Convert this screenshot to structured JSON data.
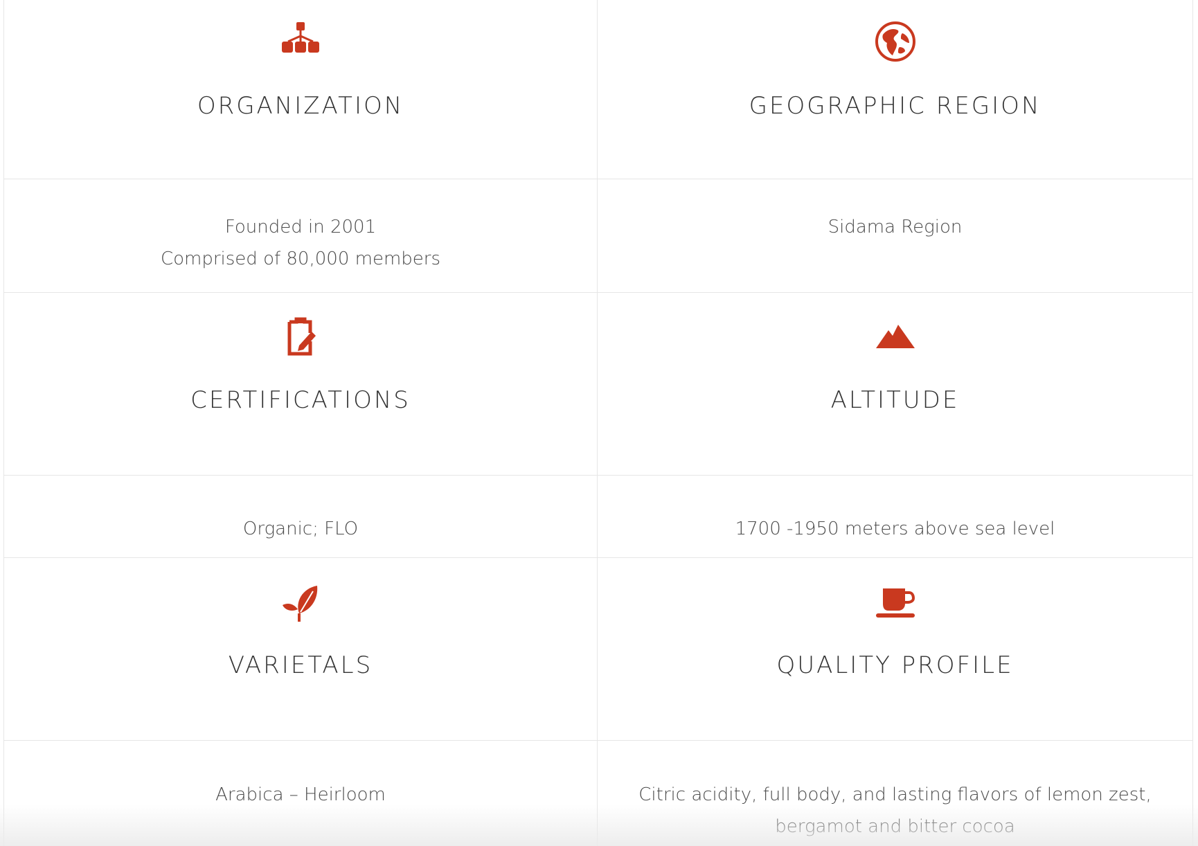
{
  "colors": {
    "accent": "#c9391f",
    "text": "#444444",
    "divider": "#e6e6e6"
  },
  "sections": [
    {
      "heading": "ORGANIZATION",
      "icon": "org-chart-icon",
      "lines": [
        "Founded in 2001",
        "Comprised of 80,000 members"
      ]
    },
    {
      "heading": "GEOGRAPHIC REGION",
      "icon": "globe-icon",
      "lines": [
        "Sidama Region"
      ]
    },
    {
      "heading": "CERTIFICATIONS",
      "icon": "clipboard-edit-icon",
      "lines": [
        "Organic; FLO"
      ]
    },
    {
      "heading": "ALTITUDE",
      "icon": "mountain-icon",
      "lines": [
        "1700 -1950 meters above sea level"
      ]
    },
    {
      "heading": "VARIETALS",
      "icon": "leaf-icon",
      "lines": [
        "Arabica – Heirloom"
      ]
    },
    {
      "heading": "QUALITY PROFILE",
      "icon": "coffee-cup-icon",
      "lines": [
        "Citric acidity, full body, and lasting flavors of  lemon zest,",
        "bergamot and bitter cocoa"
      ]
    }
  ]
}
